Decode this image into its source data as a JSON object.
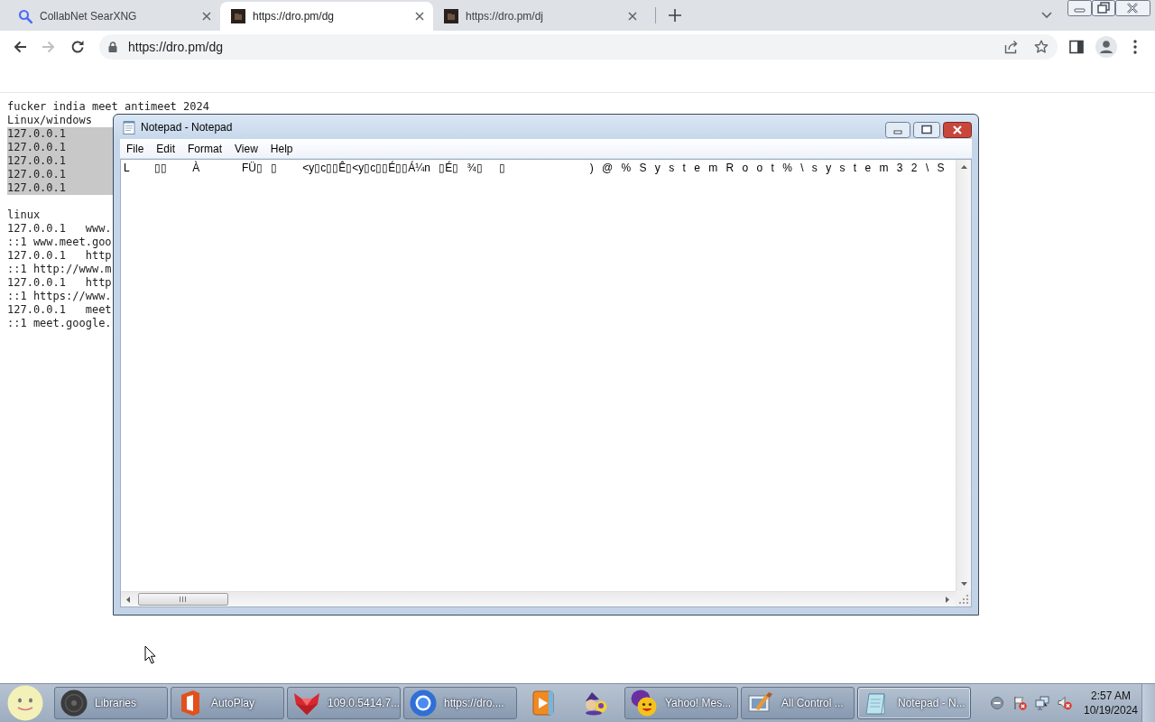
{
  "browser": {
    "tabs": [
      {
        "title": "CollabNet SearXNG",
        "selected": false
      },
      {
        "title": "https://dro.pm/dg",
        "selected": true
      },
      {
        "title": "https://dro.pm/dj",
        "selected": false
      }
    ],
    "nav": [
      {
        "kind": "back",
        "disabled": false
      },
      {
        "kind": "forward",
        "disabled": true
      },
      {
        "kind": "reload",
        "disabled": false
      }
    ],
    "address": "https://dro.pm/dg"
  },
  "page": {
    "blocks": [
      {
        "lines": [
          {
            "text": "fucker india meet antimeet 2024",
            "selected": false
          },
          {
            "text": "Linux/windows",
            "selected": false
          },
          {
            "text": "127.0.0.1",
            "selected": true
          },
          {
            "text": "127.0.0.1",
            "selected": true
          },
          {
            "text": "127.0.0.1",
            "selected": true
          },
          {
            "text": "127.0.0.1",
            "selected": true
          },
          {
            "text": "127.0.0.1",
            "selected": true
          }
        ]
      },
      {
        "lines": [
          {
            "text": "linux",
            "selected": false
          },
          {
            "text": "127.0.0.1   www.",
            "selected": false
          },
          {
            "text": "::1 www.meet.goo",
            "selected": false
          },
          {
            "text": "127.0.0.1   http",
            "selected": false
          },
          {
            "text": "::1 http://www.m",
            "selected": false
          },
          {
            "text": "127.0.0.1   http",
            "selected": false
          },
          {
            "text": "::1 https://www.",
            "selected": false
          },
          {
            "text": "127.0.0.1   meet",
            "selected": false
          },
          {
            "text": "::1 meet.google.",
            "selected": false
          }
        ]
      }
    ]
  },
  "notepad": {
    "title": "Notepad - Notepad",
    "menu": [
      "File",
      "Edit",
      "Format",
      "View",
      "Help"
    ],
    "content": "L   ▯▯   À     FÜ▯ ▯   <y▯c▯▯Ê▯<y▯c▯▯É▯▯Á¼n ▯É▯ ¾▯  ▯          ) @ % S y s t e m R o o t % \\ s y s t e m 3 2 \\ S"
  },
  "taskbar": {
    "items": [
      {
        "kind": "button",
        "label": "Libraries",
        "selected": false
      },
      {
        "kind": "button",
        "label": "AutoPlay",
        "selected": false
      },
      {
        "kind": "button",
        "label": "109.0.5414.7...",
        "selected": false
      },
      {
        "kind": "button",
        "label": "https://dro....",
        "selected": false
      },
      {
        "kind": "icon",
        "selected": false
      },
      {
        "kind": "icon",
        "selected": false
      },
      {
        "kind": "button",
        "label": "Yahoo! Mes...",
        "selected": false
      },
      {
        "kind": "button",
        "label": "All Control ...",
        "selected": false
      },
      {
        "kind": "button",
        "label": "Notepad - N...",
        "selected": true
      }
    ],
    "clock": {
      "time": "2:57 AM",
      "date": "10/19/2024"
    }
  }
}
